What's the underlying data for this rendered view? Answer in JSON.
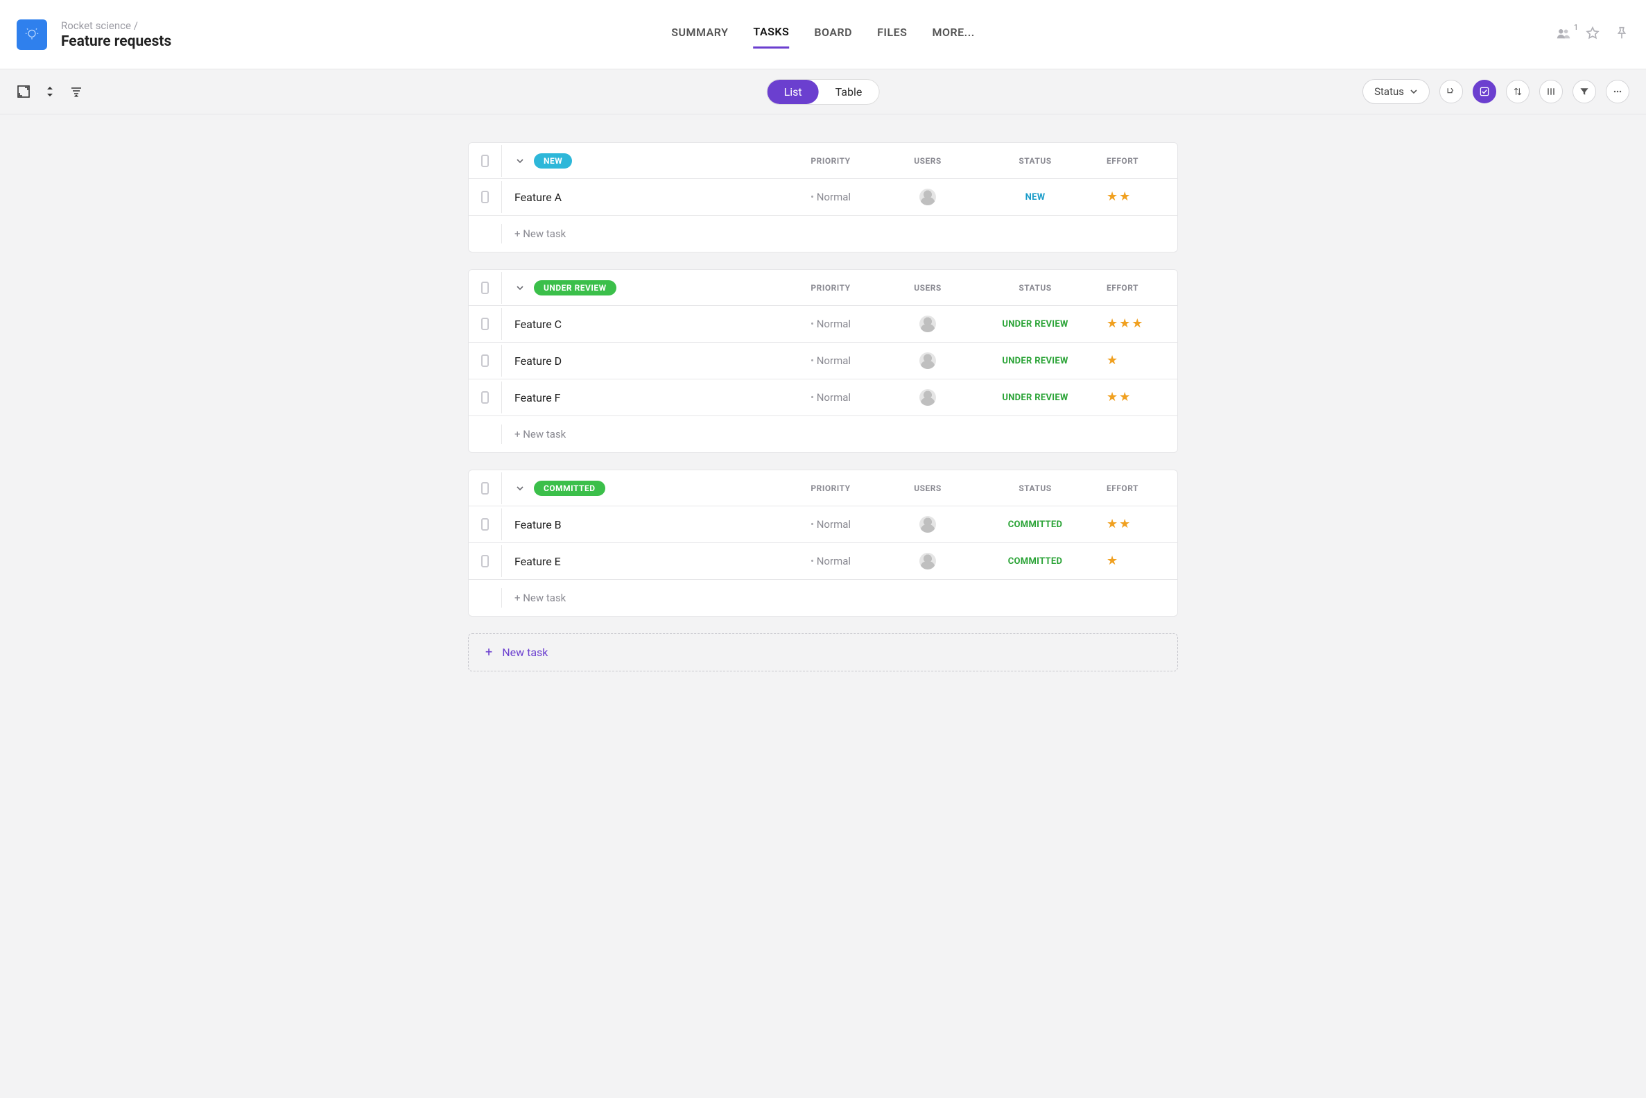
{
  "header": {
    "breadcrumb_parent": "Rocket science",
    "breadcrumb_sep": " / ",
    "title": "Feature requests",
    "follower_count": "1",
    "tabs": [
      {
        "label": "SUMMARY",
        "active": false
      },
      {
        "label": "TASKS",
        "active": true
      },
      {
        "label": "BOARD",
        "active": false
      },
      {
        "label": "FILES",
        "active": false
      },
      {
        "label": "MORE...",
        "active": false
      }
    ]
  },
  "toolbar": {
    "view_list": "List",
    "view_table": "Table",
    "status_label": "Status"
  },
  "columns": {
    "priority": "PRIORITY",
    "users": "USERS",
    "status": "STATUS",
    "effort": "EFFORT"
  },
  "groups": [
    {
      "chip": "NEW",
      "chip_class": "new",
      "rows": [
        {
          "name": "Feature A",
          "priority": "Normal",
          "status": "NEW",
          "status_class": "new",
          "effort": 2
        }
      ],
      "new_task": "+ New task"
    },
    {
      "chip": "UNDER REVIEW",
      "chip_class": "green",
      "rows": [
        {
          "name": "Feature C",
          "priority": "Normal",
          "status": "UNDER REVIEW",
          "status_class": "green",
          "effort": 3
        },
        {
          "name": "Feature D",
          "priority": "Normal",
          "status": "UNDER REVIEW",
          "status_class": "green",
          "effort": 1
        },
        {
          "name": "Feature F",
          "priority": "Normal",
          "status": "UNDER REVIEW",
          "status_class": "green",
          "effort": 2
        }
      ],
      "new_task": "+ New task"
    },
    {
      "chip": "COMMITTED",
      "chip_class": "green",
      "rows": [
        {
          "name": "Feature B",
          "priority": "Normal",
          "status": "COMMITTED",
          "status_class": "green",
          "effort": 2
        },
        {
          "name": "Feature E",
          "priority": "Normal",
          "status": "COMMITTED",
          "status_class": "green",
          "effort": 1
        }
      ],
      "new_task": "+ New task"
    }
  ],
  "footer": {
    "new_task_label": "New task",
    "plus": "+"
  }
}
